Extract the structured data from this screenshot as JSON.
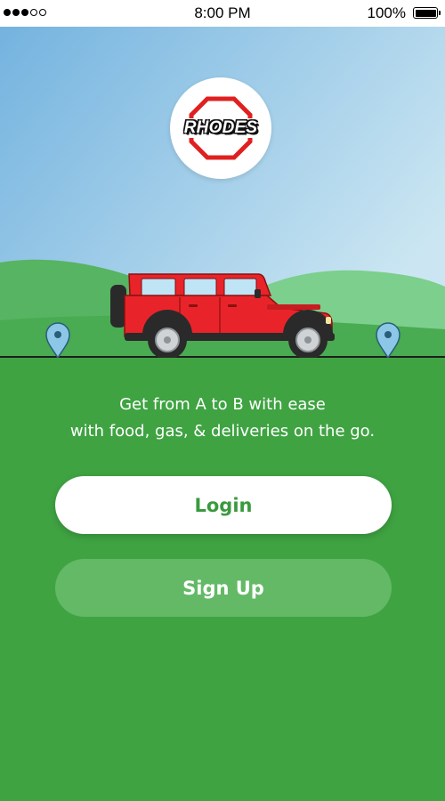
{
  "status_bar": {
    "time": "8:00 PM",
    "battery_label": "100%",
    "battery_level": 1.0,
    "signal_bars_filled": 3,
    "signal_bars_total": 5
  },
  "brand": {
    "logo_text": "RHODES",
    "accent_color": "#3fa342",
    "logo_red": "#e02020"
  },
  "hero": {
    "sky_top": "#7ab8e0",
    "sky_bottom": "#cfe7f2",
    "vehicle_color": "#e8242a",
    "icons": [
      "location-pin-icon",
      "jeep-icon",
      "location-pin-icon"
    ]
  },
  "tagline": {
    "line1": "Get from A to B with ease",
    "line2": "with food, gas, & deliveries on the go."
  },
  "actions": {
    "login_label": "Login",
    "signup_label": "Sign Up"
  }
}
